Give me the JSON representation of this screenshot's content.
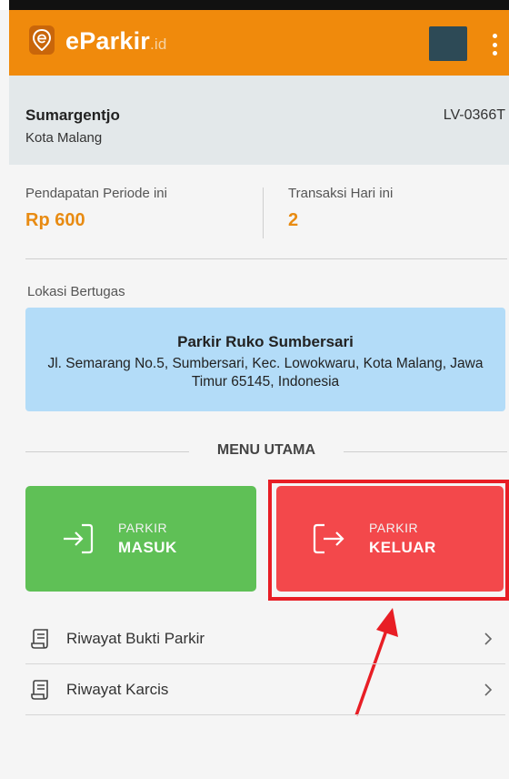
{
  "app": {
    "brand": "eParkir",
    "brand_suffix": ".id",
    "accent_color": "#f08a0c",
    "icons": {
      "logo": "location-pin-e-icon",
      "menu": "more-vertical-icon"
    }
  },
  "user": {
    "name": "Sumargentjo",
    "city": "Kota Malang",
    "code": "LV-0366T"
  },
  "stats": {
    "income_label": "Pendapatan Periode ini",
    "income_value": "Rp 600",
    "tx_label": "Transaksi Hari ini",
    "tx_value": "2"
  },
  "location": {
    "label": "Lokasi Bertugas",
    "name": "Parkir Ruko Sumbersari",
    "address": "Jl. Semarang No.5, Sumbersari, Kec. Lowokwaru, Kota Malang, Jawa Timur 65145, Indonesia"
  },
  "menu": {
    "title": "MENU UTAMA",
    "park_in": {
      "small": "PARKIR",
      "big": "MASUK",
      "color": "#5fc056",
      "icon": "sign-in-icon"
    },
    "park_out": {
      "small": "PARKIR",
      "big": "KELUAR",
      "color": "#f3484b",
      "icon": "sign-out-icon"
    }
  },
  "list": [
    {
      "label": "Riwayat Bukti Parkir",
      "icon": "receipt-scroll-icon"
    },
    {
      "label": "Riwayat Karcis",
      "icon": "receipt-scroll-icon"
    }
  ],
  "annotation": {
    "highlight_color": "#e81e25"
  }
}
